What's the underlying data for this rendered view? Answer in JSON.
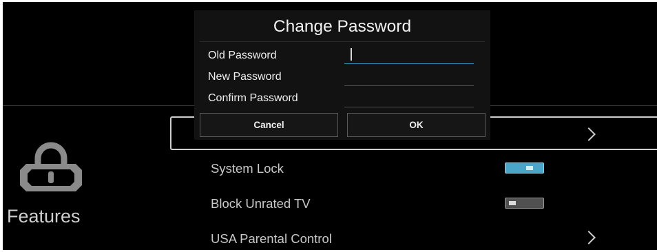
{
  "colors": {
    "background": "#000000",
    "accent": "#4aa5c8",
    "text": "#c8c8c8",
    "dialog_bg": "#121212"
  },
  "sidebar": {
    "icon": "lock-icon",
    "title": "Features"
  },
  "menu": {
    "items": [
      {
        "label": "",
        "type": "submenu",
        "icon": "chevron-right-icon",
        "selected": true
      },
      {
        "label": "System Lock",
        "type": "toggle",
        "state": "on"
      },
      {
        "label": "Block Unrated TV",
        "type": "toggle",
        "state": "off"
      },
      {
        "label": "USA Parental Control",
        "type": "submenu",
        "icon": "chevron-right-icon"
      }
    ]
  },
  "dialog": {
    "title": "Change Password",
    "fields": [
      {
        "label": "Old Password",
        "value": "",
        "focused": true
      },
      {
        "label": "New Password",
        "value": ""
      },
      {
        "label": "Confirm Password",
        "value": ""
      }
    ],
    "cancel_label": "Cancel",
    "ok_label": "OK"
  }
}
